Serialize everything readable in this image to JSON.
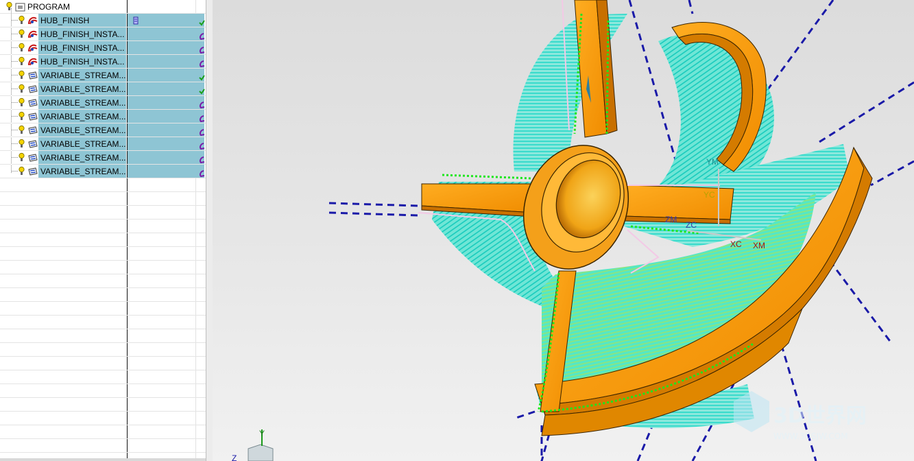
{
  "navigator": {
    "root": {
      "label": "PROGRAM",
      "icon": "program-folder-icon"
    },
    "operations": [
      {
        "label": "HUB_FINISH",
        "icon": "hub-finish-icon",
        "status": "check"
      },
      {
        "label": "HUB_FINISH_INSTA...",
        "icon": "hub-finish-icon",
        "status": "regenerate"
      },
      {
        "label": "HUB_FINISH_INSTA...",
        "icon": "hub-finish-icon",
        "status": "regenerate"
      },
      {
        "label": "HUB_FINISH_INSTA...",
        "icon": "hub-finish-icon",
        "status": "regenerate"
      },
      {
        "label": "VARIABLE_STREAM...",
        "icon": "variable-streamline-icon",
        "status": "check"
      },
      {
        "label": "VARIABLE_STREAM...",
        "icon": "variable-streamline-icon",
        "status": "check"
      },
      {
        "label": "VARIABLE_STREAM...",
        "icon": "variable-streamline-icon",
        "status": "regenerate"
      },
      {
        "label": "VARIABLE_STREAM...",
        "icon": "variable-streamline-icon",
        "status": "regenerate"
      },
      {
        "label": "VARIABLE_STREAM...",
        "icon": "variable-streamline-icon",
        "status": "regenerate"
      },
      {
        "label": "VARIABLE_STREAM...",
        "icon": "variable-streamline-icon",
        "status": "regenerate"
      },
      {
        "label": "VARIABLE_STREAM...",
        "icon": "variable-streamline-icon",
        "status": "regenerate"
      },
      {
        "label": "VARIABLE_STREAM...",
        "icon": "variable-streamline-icon",
        "status": "regenerate"
      }
    ],
    "selection_color": "#8ec5d4"
  },
  "viewport": {
    "wcs_labels": {
      "ym": "YM",
      "yc": "YC",
      "zm": "ZM",
      "zc": "ZC",
      "xc": "XC",
      "xm": "XM"
    },
    "triad_labels": {
      "y": "Y",
      "z": "Z"
    },
    "colors": {
      "part": "#f29a0e",
      "toolpath": "#22e6d2",
      "boundary": "#1ee61e",
      "projection": "#1a1aa8"
    },
    "watermark": {
      "title": "3D世界网",
      "url": "WWW.3DSJW.COM"
    }
  }
}
